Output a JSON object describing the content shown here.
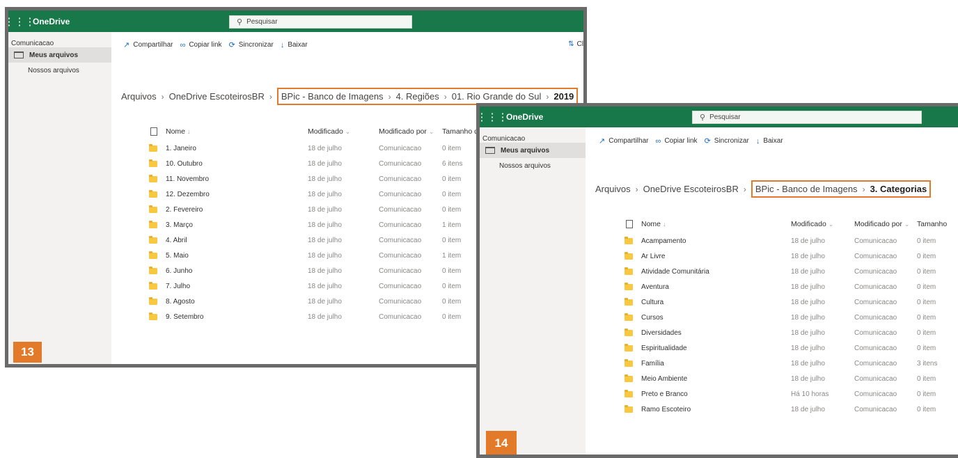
{
  "colors": {
    "header": "#18784a",
    "highlight": "#e27a2a",
    "folder": "#f8c940"
  },
  "screens": [
    {
      "badge": "13",
      "app_name": "OneDrive",
      "search_placeholder": "Pesquisar",
      "user": "Comunicacao",
      "nav": [
        "Meus arquivos",
        "Nossos arquivos"
      ],
      "commands": [
        {
          "icon": "share-icon",
          "label": "Compartilhar"
        },
        {
          "icon": "link-icon",
          "label": "Copiar link"
        },
        {
          "icon": "sync-icon",
          "label": "Sincronizar"
        },
        {
          "icon": "download-icon",
          "label": "Baixar"
        }
      ],
      "sort_label": "Cl",
      "breadcrumb_plain": [
        "Arquivos",
        "OneDrive EscoteirosBR"
      ],
      "breadcrumb_highlight": [
        "BPic - Banco de Imagens",
        "4. Regiões",
        "01. Rio Grande do Sul"
      ],
      "breadcrumb_current": "2019",
      "columns": {
        "name": "Nome",
        "modified": "Modificado",
        "modified_by": "Modificado por",
        "size": "Tamanho d"
      },
      "rows": [
        {
          "name": "1. Janeiro",
          "modified": "18 de julho",
          "by": "Comunicacao",
          "size": "0 item"
        },
        {
          "name": "10. Outubro",
          "modified": "18 de julho",
          "by": "Comunicacao",
          "size": "6 itens"
        },
        {
          "name": "11. Novembro",
          "modified": "18 de julho",
          "by": "Comunicacao",
          "size": "0 item"
        },
        {
          "name": "12. Dezembro",
          "modified": "18 de julho",
          "by": "Comunicacao",
          "size": "0 item"
        },
        {
          "name": "2. Fevereiro",
          "modified": "18 de julho",
          "by": "Comunicacao",
          "size": "0 item"
        },
        {
          "name": "3. Março",
          "modified": "18 de julho",
          "by": "Comunicacao",
          "size": "1 item"
        },
        {
          "name": "4. Abril",
          "modified": "18 de julho",
          "by": "Comunicacao",
          "size": "0 item"
        },
        {
          "name": "5. Maio",
          "modified": "18 de julho",
          "by": "Comunicacao",
          "size": "1 item"
        },
        {
          "name": "6. Junho",
          "modified": "18 de julho",
          "by": "Comunicacao",
          "size": "0 item"
        },
        {
          "name": "7. Julho",
          "modified": "18 de julho",
          "by": "Comunicacao",
          "size": "0 item"
        },
        {
          "name": "8. Agosto",
          "modified": "18 de julho",
          "by": "Comunicacao",
          "size": "0 item"
        },
        {
          "name": "9. Setembro",
          "modified": "18 de julho",
          "by": "Comunicacao",
          "size": "0 item"
        }
      ]
    },
    {
      "badge": "14",
      "app_name": "OneDrive",
      "search_placeholder": "Pesquisar",
      "user": "Comunicacao",
      "nav": [
        "Meus arquivos",
        "Nossos arquivos"
      ],
      "commands": [
        {
          "icon": "share-icon",
          "label": "Compartilhar"
        },
        {
          "icon": "link-icon",
          "label": "Copiar link"
        },
        {
          "icon": "sync-icon",
          "label": "Sincronizar"
        },
        {
          "icon": "download-icon",
          "label": "Baixar"
        }
      ],
      "breadcrumb_plain": [
        "Arquivos",
        "OneDrive EscoteirosBR"
      ],
      "breadcrumb_highlight": [
        "BPic - Banco de Imagens"
      ],
      "breadcrumb_current": "3. Categorias",
      "columns": {
        "name": "Nome",
        "modified": "Modificado",
        "modified_by": "Modificado por",
        "size": "Tamanho"
      },
      "rows": [
        {
          "name": "Acampamento",
          "modified": "18 de julho",
          "by": "Comunicacao",
          "size": "0 item"
        },
        {
          "name": "Ar Livre",
          "modified": "18 de julho",
          "by": "Comunicacao",
          "size": "0 item"
        },
        {
          "name": "Atividade Comunitária",
          "modified": "18 de julho",
          "by": "Comunicacao",
          "size": "0 item"
        },
        {
          "name": "Aventura",
          "modified": "18 de julho",
          "by": "Comunicacao",
          "size": "0 item"
        },
        {
          "name": "Cultura",
          "modified": "18 de julho",
          "by": "Comunicacao",
          "size": "0 item"
        },
        {
          "name": "Cursos",
          "modified": "18 de julho",
          "by": "Comunicacao",
          "size": "0 item"
        },
        {
          "name": "Diversidades",
          "modified": "18 de julho",
          "by": "Comunicacao",
          "size": "0 item"
        },
        {
          "name": "Espiritualidade",
          "modified": "18 de julho",
          "by": "Comunicacao",
          "size": "0 item"
        },
        {
          "name": "Família",
          "modified": "18 de julho",
          "by": "Comunicacao",
          "size": "3 itens"
        },
        {
          "name": "Meio Ambiente",
          "modified": "18 de julho",
          "by": "Comunicacao",
          "size": "0 item"
        },
        {
          "name": "Preto e Branco",
          "modified": "Há 10 horas",
          "by": "Comunicacao",
          "size": "0 item"
        },
        {
          "name": "Ramo Escoteiro",
          "modified": "18 de julho",
          "by": "Comunicacao",
          "size": "0 item"
        }
      ]
    }
  ]
}
